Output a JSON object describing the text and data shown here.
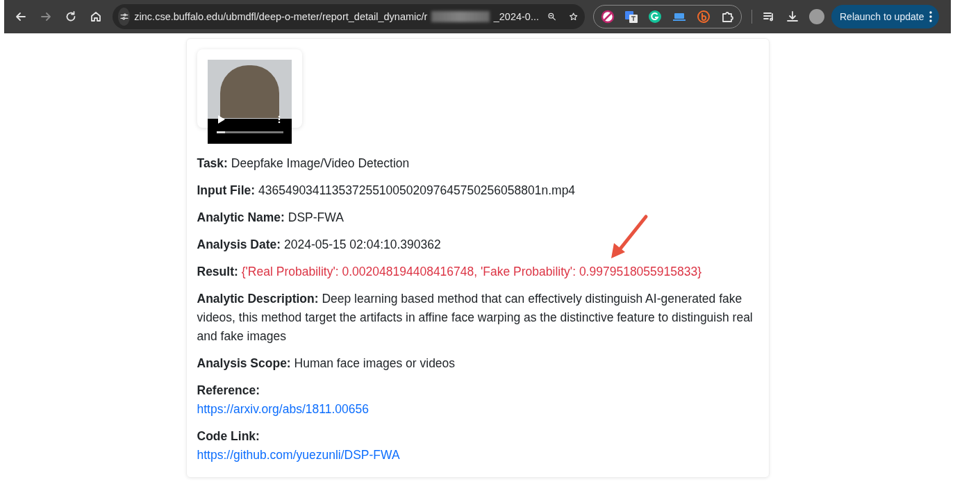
{
  "browser": {
    "url_start": "zinc.cse.buffalo.edu/ubmdfl/deep-o-meter/report_detail_dynamic/r",
    "url_end": "_2024-0...",
    "update_button": "Relaunch to update"
  },
  "report": {
    "video_player": {
      "level": 0.13
    },
    "fields": [
      {
        "kind": "text",
        "label": "Task:",
        "value": "Deepfake Image/Video Detection"
      },
      {
        "kind": "text",
        "label": "Input File:",
        "value": "436549034113537255100502097645750256058801n.mp4"
      },
      {
        "kind": "text",
        "label": "Analytic Name:",
        "value": "DSP-FWA"
      },
      {
        "kind": "text",
        "label": "Analysis Date:",
        "value": "2024-05-15 02:04:10.390362"
      },
      {
        "kind": "alert",
        "label": "Result:",
        "value": "{'Real Probability': 0.002048194408416748, 'Fake Probability': 0.9979518055915833}"
      },
      {
        "kind": "text",
        "label": "Analytic Description:",
        "value": "Deep learning based method that can effectively distinguish AI-generated fake videos, this method target the artifacts in affine face warping as the distinctive feature to distinguish real and fake images"
      },
      {
        "kind": "text",
        "label": "Analysis Scope:",
        "value": "Human face images or videos"
      },
      {
        "kind": "link",
        "label": "Reference:",
        "value": "https://arxiv.org/abs/1811.00656"
      },
      {
        "kind": "link",
        "label": "Code Link:",
        "value": "https://github.com/yuezunli/DSP-FWA"
      }
    ]
  }
}
